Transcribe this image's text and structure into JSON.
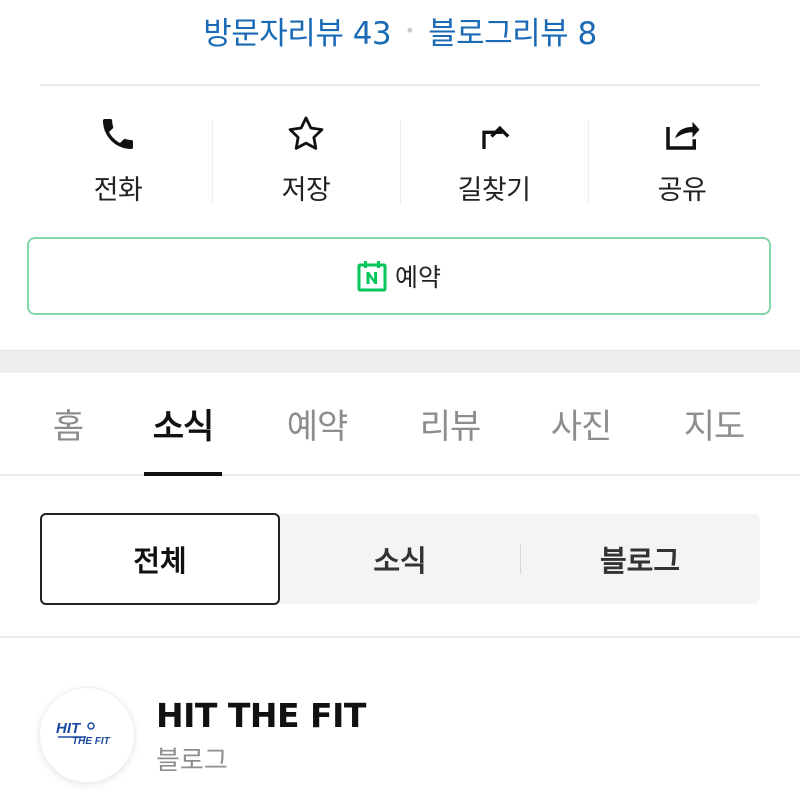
{
  "reviews": {
    "visitor_label": "방문자리뷰 43",
    "separator": "•",
    "blog_label": "블로그리뷰 8"
  },
  "actions": [
    {
      "label": "전화",
      "icon": "phone-icon"
    },
    {
      "label": "저장",
      "icon": "star-icon"
    },
    {
      "label": "길찾기",
      "icon": "directions-icon"
    },
    {
      "label": "공유",
      "icon": "share-icon"
    }
  ],
  "booking": {
    "label": "예약",
    "icon": "naver-booking-icon",
    "border_color": "#7fd9a3",
    "icon_color": "#03c75a"
  },
  "tabs": [
    {
      "label": "홈",
      "active": false
    },
    {
      "label": "소식",
      "active": true
    },
    {
      "label": "예약",
      "active": false
    },
    {
      "label": "리뷰",
      "active": false
    },
    {
      "label": "사진",
      "active": false
    },
    {
      "label": "지도",
      "active": false
    }
  ],
  "filter": [
    {
      "label": "전체",
      "active": true
    },
    {
      "label": "소식",
      "active": false
    },
    {
      "label": "블로그",
      "active": false
    }
  ],
  "post": {
    "author": "HIT THE FIT",
    "source": "블로그",
    "avatar_logo_text": "HIT THE FIT"
  },
  "colors": {
    "link_blue": "#1a6ab5",
    "active_text": "#111111",
    "inactive_text": "#8d8d8d",
    "logo_blue": "#1a4aa0"
  }
}
